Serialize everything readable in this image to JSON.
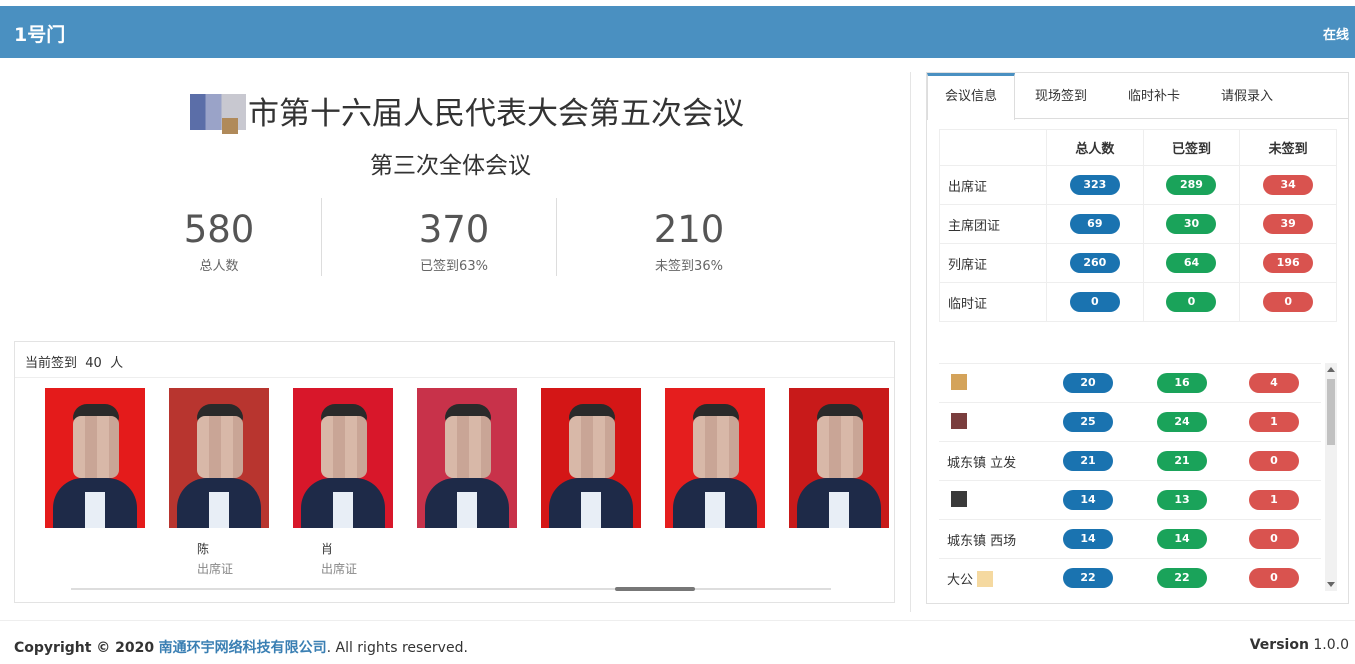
{
  "header": {
    "title": "1号门",
    "status": "在线"
  },
  "meeting": {
    "title": "市第十六届人民代表大会第五次会议",
    "subtitle": "第三次全体会议"
  },
  "stats": [
    {
      "value": "580",
      "label": "总人数"
    },
    {
      "value": "370",
      "label": "已签到63%"
    },
    {
      "value": "210",
      "label": "未签到36%"
    }
  ],
  "checkin_panel": {
    "label": "当前签到",
    "count": "40",
    "unit": "人"
  },
  "people": [
    {
      "name": "",
      "type": "",
      "bg": "#e41b1b"
    },
    {
      "name": "陈",
      "type": "出席证",
      "bg": "#b8352f"
    },
    {
      "name": "肖",
      "type": "出席证",
      "bg": "#d8172a"
    },
    {
      "name": "",
      "type": "",
      "bg": "#c8324a"
    },
    {
      "name": "",
      "type": "",
      "bg": "#d41616"
    },
    {
      "name": "",
      "type": "",
      "bg": "#e51e1e"
    },
    {
      "name": "",
      "type": "",
      "bg": "#c81a1a"
    }
  ],
  "tabs": [
    {
      "label": "会议信息"
    },
    {
      "label": "现场签到"
    },
    {
      "label": "临时补卡"
    },
    {
      "label": "请假录入"
    }
  ],
  "summary": {
    "headers": [
      "总人数",
      "已签到",
      "未签到"
    ],
    "rows": [
      {
        "label": "出席证",
        "total": "323",
        "signed": "289",
        "unsigned": "34"
      },
      {
        "label": "主席团证",
        "total": "69",
        "signed": "30",
        "unsigned": "39"
      },
      {
        "label": "列席证",
        "total": "260",
        "signed": "64",
        "unsigned": "196"
      },
      {
        "label": "临时证",
        "total": "0",
        "signed": "0",
        "unsigned": "0"
      }
    ]
  },
  "groups": [
    {
      "label": "",
      "total": "20",
      "signed": "16",
      "unsigned": "4",
      "blur": "#d4a35a"
    },
    {
      "label": "",
      "total": "25",
      "signed": "24",
      "unsigned": "1",
      "blur": "#7a3e3e"
    },
    {
      "label": "城东镇 立发",
      "total": "21",
      "signed": "21",
      "unsigned": "0",
      "blur": ""
    },
    {
      "label": "",
      "total": "14",
      "signed": "13",
      "unsigned": "1",
      "blur": "#3a3a3a"
    },
    {
      "label": "城东镇 西场",
      "total": "14",
      "signed": "14",
      "unsigned": "0",
      "blur": ""
    },
    {
      "label": "大公",
      "total": "22",
      "signed": "22",
      "unsigned": "0",
      "blur": "#f5d9a0"
    }
  ],
  "footer": {
    "copyright_prefix": "Copyright © 2020",
    "company": "南通环宇网络科技有限公司",
    "copyright_suffix": ". All rights reserved.",
    "version_label": "Version",
    "version": "1.0.0"
  },
  "colors": {
    "header": "#4a90c1",
    "blue": "#1a73b0",
    "green": "#1aa35a",
    "red": "#d9534f"
  }
}
